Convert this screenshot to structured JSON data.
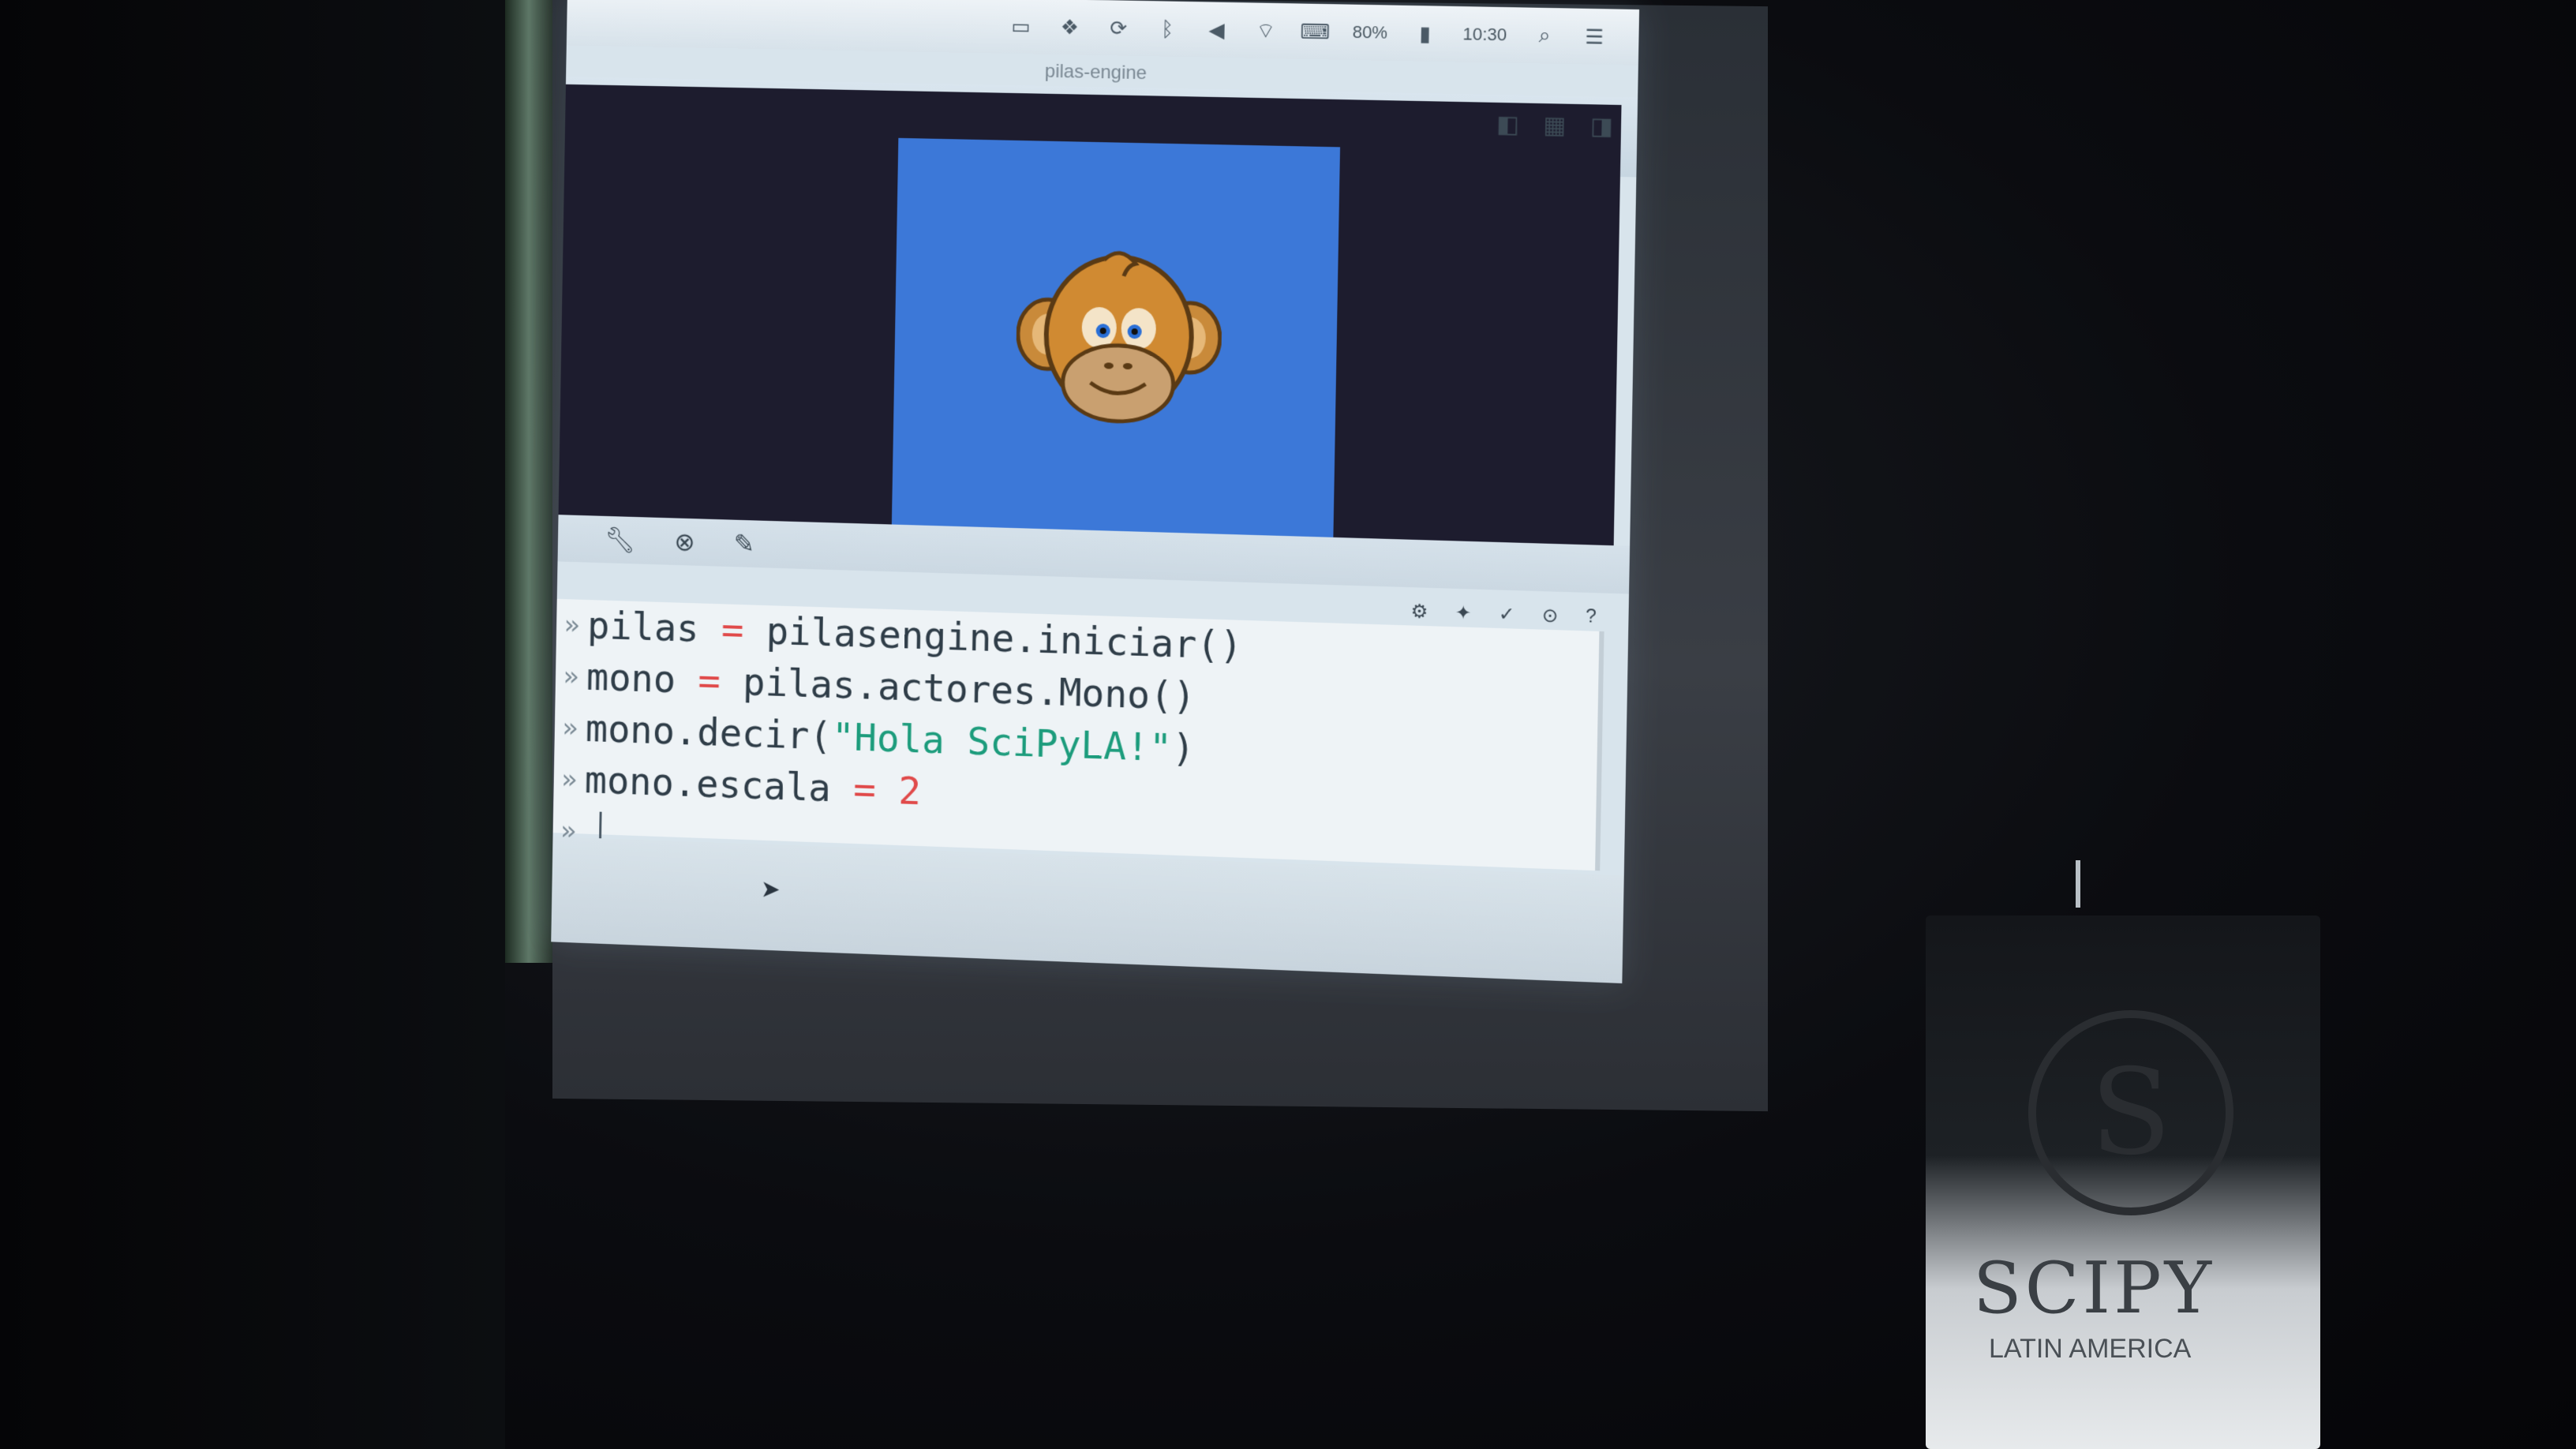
{
  "menubar": {
    "icons": [
      "display-icon",
      "dropbox-icon",
      "sync-icon",
      "bluetooth-icon",
      "volume-icon",
      "wifi-icon",
      "keyboard-icon",
      "battery-icon",
      "search-icon",
      "menu-icon"
    ],
    "battery": "80%",
    "clock": "10:30"
  },
  "window": {
    "title": "pilas-engine"
  },
  "game": {
    "background_color": "#3c78d8",
    "actor": "monkey"
  },
  "editor": {
    "lines": [
      {
        "prompt": "»",
        "parts": [
          {
            "t": "pilas",
            "c": ""
          },
          {
            "t": " = ",
            "c": "op"
          },
          {
            "t": "pilasengine.iniciar()",
            "c": ""
          }
        ]
      },
      {
        "prompt": "»",
        "parts": [
          {
            "t": "mono",
            "c": ""
          },
          {
            "t": " = ",
            "c": "op"
          },
          {
            "t": "pilas.actores.Mono()",
            "c": ""
          }
        ]
      },
      {
        "prompt": "»",
        "parts": [
          {
            "t": "mono.decir(",
            "c": ""
          },
          {
            "t": "\"Hola SciPyLA!\"",
            "c": "str"
          },
          {
            "t": ")",
            "c": ""
          }
        ]
      },
      {
        "prompt": "»",
        "parts": [
          {
            "t": "mono.escala",
            "c": ""
          },
          {
            "t": " = ",
            "c": "op"
          },
          {
            "t": "2",
            "c": "num"
          }
        ]
      }
    ],
    "input_prompt": "»"
  },
  "banner": {
    "logo": "S",
    "title": "SCIPY",
    "subtitle": "LATIN AMERICA"
  }
}
